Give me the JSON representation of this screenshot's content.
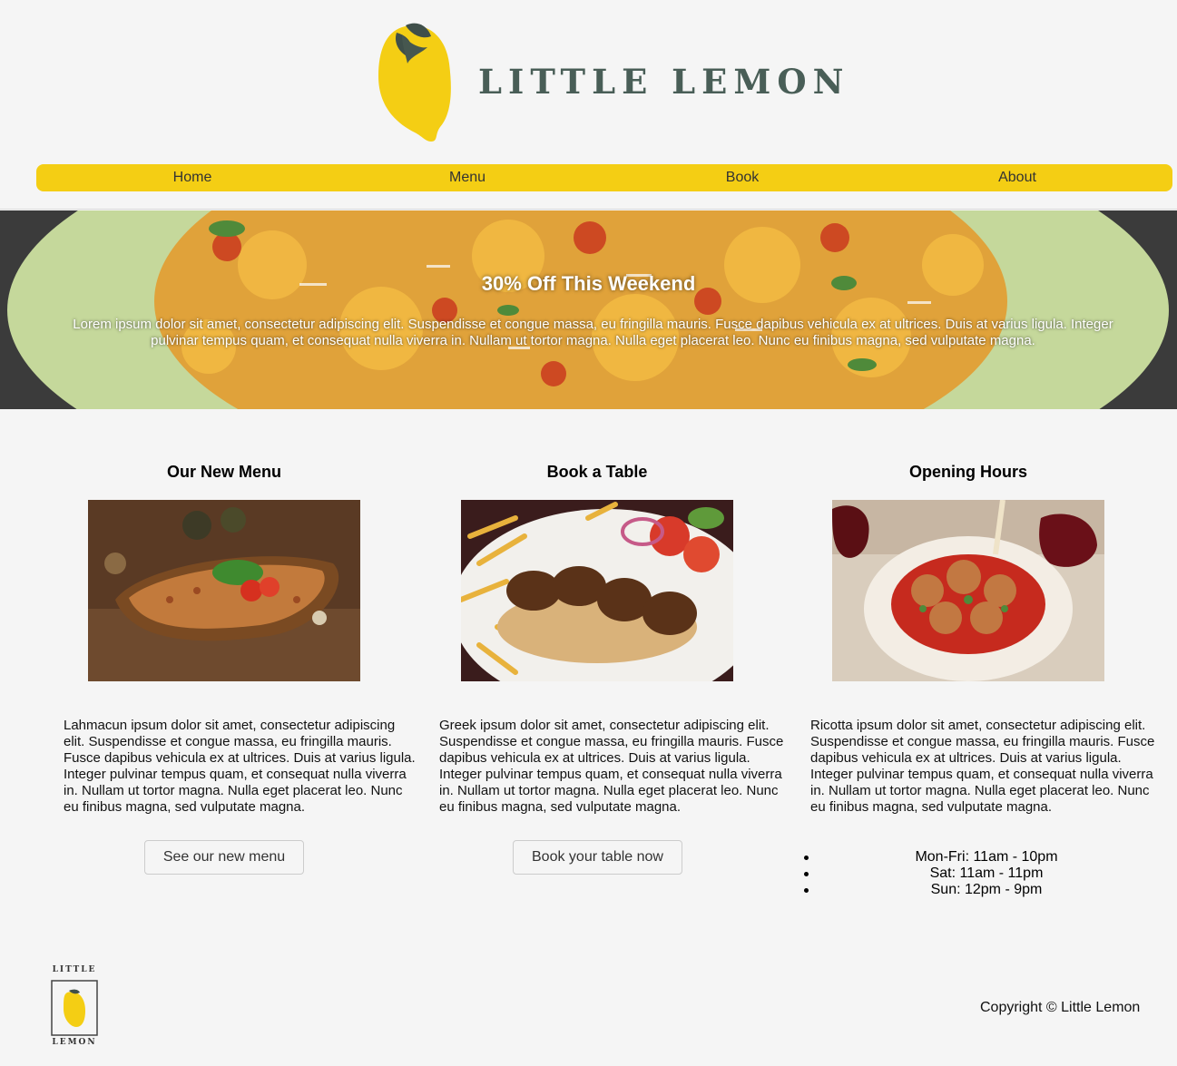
{
  "brand": {
    "name": "LITTLE LEMON",
    "footer_top": "LITTLE",
    "footer_bottom": "LEMON"
  },
  "nav": {
    "items": [
      "Home",
      "Menu",
      "Book",
      "About"
    ]
  },
  "hero": {
    "title": "30% Off This Weekend",
    "text": "Lorem ipsum dolor sit amet, consectetur adipiscing elit. Suspendisse et congue massa, eu fringilla mauris. Fusce dapibus vehicula ex at ultrices. Duis at varius ligula. Integer pulvinar tempus quam, et consequat nulla viverra in. Nullam ut tortor magna. Nulla eget placerat leo. Nunc eu finibus magna, sed vulputate magna."
  },
  "columns": [
    {
      "title": "Our New Menu",
      "text": "Lahmacun ipsum dolor sit amet, consectetur adipiscing elit. Suspendisse et congue massa, eu fringilla mauris. Fusce dapibus vehicula ex at ultrices. Duis at varius ligula. Integer pulvinar tempus quam, et consequat nulla viverra in. Nullam ut tortor magna. Nulla eget placerat leo. Nunc eu finibus magna, sed vulputate magna.",
      "button": "See our new menu"
    },
    {
      "title": "Book a Table",
      "text": "Greek ipsum dolor sit amet, consectetur adipiscing elit. Suspendisse et congue massa, eu fringilla mauris. Fusce dapibus vehicula ex at ultrices. Duis at varius ligula. Integer pulvinar tempus quam, et consequat nulla viverra in. Nullam ut tortor magna. Nulla eget placerat leo. Nunc eu finibus magna, sed vulputate magna.",
      "button": "Book your table now"
    },
    {
      "title": "Opening Hours",
      "text": "Ricotta ipsum dolor sit amet, consectetur adipiscing elit. Suspendisse et congue massa, eu fringilla mauris. Fusce dapibus vehicula ex at ultrices. Duis at varius ligula. Integer pulvinar tempus quam, et consequat nulla viverra in. Nullam ut tortor magna. Nulla eget placerat leo. Nunc eu finibus magna, sed vulputate magna.",
      "hours": [
        "Mon-Fri: 11am - 10pm",
        "Sat: 11am - 11pm",
        "Sun: 12pm - 9pm"
      ]
    }
  ],
  "footer": {
    "copyright": "Copyright © Little Lemon"
  },
  "colors": {
    "brand_yellow": "#f4ce14",
    "brand_green": "#495e57",
    "background": "#f5f5f5"
  }
}
